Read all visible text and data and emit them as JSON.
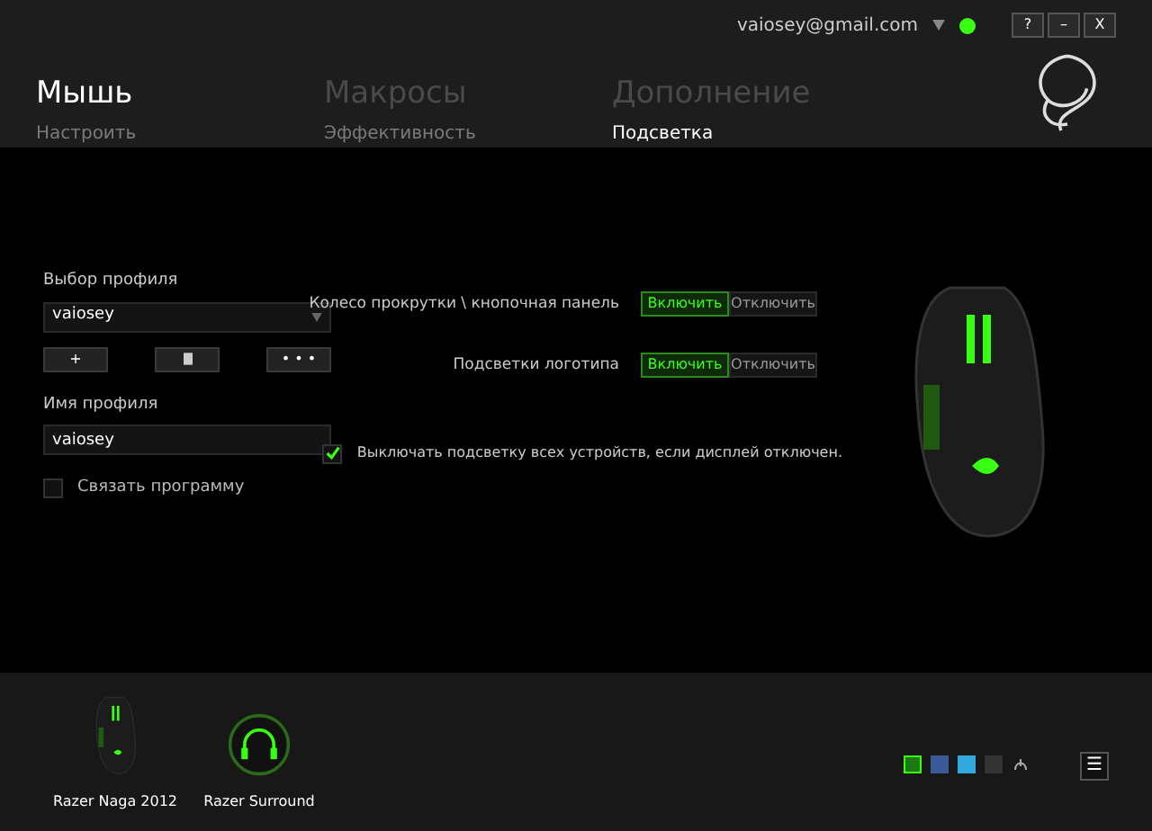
{
  "account": {
    "email": "vaiosey@gmail.com",
    "online": true
  },
  "window_buttons": [
    "?",
    "–",
    "X"
  ],
  "tabs": [
    {
      "label": "Мышь",
      "selected": true
    },
    {
      "label": "Макросы",
      "selected": false
    },
    {
      "label": "Дополнение",
      "selected": false
    }
  ],
  "subtabs": [
    {
      "label": "Настроить",
      "selected": false
    },
    {
      "label": "Эффективность",
      "selected": false
    },
    {
      "label": "Подсветка",
      "selected": true
    }
  ],
  "profile": {
    "label": "Выбор профиля",
    "value": "vaiosey",
    "buttons": [
      {
        "kind": "add",
        "text": "+"
      },
      {
        "kind": "delete"
      },
      {
        "kind": "more",
        "text": "• • •"
      }
    ],
    "name_label": "Имя профиля",
    "name_value": "vaiosey",
    "link": {
      "label": "Связать программу",
      "checked": false
    }
  },
  "lighting": [
    {
      "label": "Колесо прокрутки \\ кнопочная панель",
      "options": [
        {
          "label": "Включить",
          "selected": true
        },
        {
          "label": "Отключить",
          "selected": false
        }
      ]
    },
    {
      "label": "Подсветки логотипа",
      "options": [
        {
          "label": "Включить",
          "selected": true
        },
        {
          "label": "Отключить",
          "selected": false
        }
      ]
    }
  ],
  "display_off": {
    "label": "Выключать подсветку всех устройств, если дисплей отключен.",
    "checked": true
  },
  "devices": [
    {
      "kind": "mouse",
      "name": "Razer Naga 2012"
    },
    {
      "kind": "headset",
      "name": "Razer Surround"
    }
  ],
  "menu_button": "☰"
}
